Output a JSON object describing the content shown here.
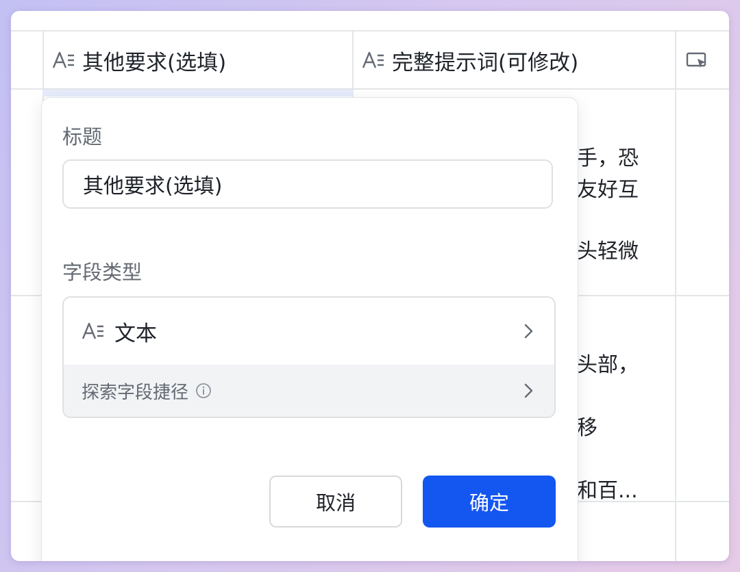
{
  "table": {
    "columns": [
      {
        "label": "其他要求(选填)",
        "icon": "text-field-icon"
      },
      {
        "label": "完整提示词(可修改)",
        "icon": "text-field-icon"
      },
      {
        "label": "",
        "icon": "ai-field-icon"
      }
    ],
    "visible_cell_fragments": [
      "手，恐",
      "友好互",
      "头轻微",
      "头部，",
      "移",
      "和百..."
    ]
  },
  "dialog": {
    "title_label": "标题",
    "title_value": "其他要求(选填)",
    "field_type_label": "字段类型",
    "field_type": {
      "label": "文本",
      "icon": "text-field-icon"
    },
    "explore_shortcut": {
      "label": "探索字段捷径",
      "icon": "info-icon"
    },
    "cancel_label": "取消",
    "confirm_label": "确定"
  },
  "colors": {
    "primary": "#1456f0",
    "text": "#1f2329",
    "muted_text": "#646a73",
    "border": "#dee0e3",
    "explore_bg": "#f2f3f5"
  }
}
